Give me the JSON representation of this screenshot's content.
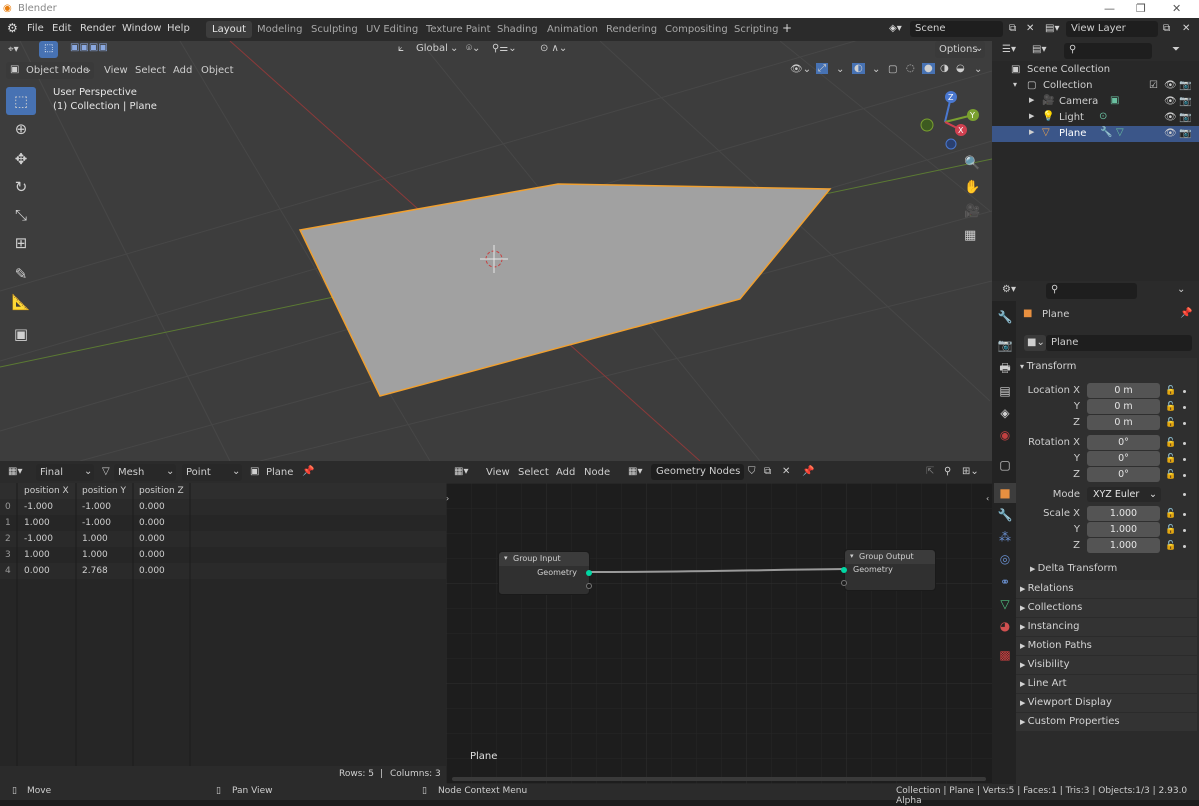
{
  "window": {
    "title": "Blender"
  },
  "menu": {
    "file": "File",
    "edit": "Edit",
    "render": "Render",
    "window": "Window",
    "help": "Help"
  },
  "workspaces": [
    {
      "label": "Layout",
      "active": true
    },
    {
      "label": "Modeling"
    },
    {
      "label": "Sculpting"
    },
    {
      "label": "UV Editing"
    },
    {
      "label": "Texture Paint"
    },
    {
      "label": "Shading"
    },
    {
      "label": "Animation"
    },
    {
      "label": "Rendering"
    },
    {
      "label": "Compositing"
    },
    {
      "label": "Scripting"
    }
  ],
  "top_right": {
    "scene": "Scene",
    "view_layer": "View Layer"
  },
  "viewport": {
    "orientation": "Global",
    "options": "Options",
    "mode": "Object Mode",
    "menus": {
      "view": "View",
      "select": "Select",
      "add": "Add",
      "object": "Object"
    },
    "overlay_text_1": "User Perspective",
    "overlay_text_2": "(1) Collection | Plane",
    "gizmo": {
      "x": "X",
      "y": "Y",
      "z": "Z"
    }
  },
  "outliner": {
    "root": "Scene Collection",
    "collection": "Collection",
    "items": [
      {
        "label": "Camera"
      },
      {
        "label": "Light"
      },
      {
        "label": "Plane",
        "selected": true
      }
    ]
  },
  "properties": {
    "object_name": "Plane",
    "data_name": "Plane",
    "transform": {
      "header": "Transform",
      "location_label": "Location X",
      "location": [
        "0 m",
        "0 m",
        "0 m"
      ],
      "rotation_label": "Rotation X",
      "rotation": [
        "0°",
        "0°",
        "0°"
      ],
      "mode_label": "Mode",
      "mode": "XYZ Euler",
      "scale_label": "Scale X",
      "scale": [
        "1.000",
        "1.000",
        "1.000"
      ],
      "axis_y": "Y",
      "axis_z": "Z"
    },
    "delta_transform": "Delta Transform",
    "panels": [
      "Relations",
      "Collections",
      "Instancing",
      "Motion Paths",
      "Visibility",
      "Line Art",
      "Viewport Display",
      "Custom Properties"
    ]
  },
  "spreadsheet": {
    "header": {
      "evaluation": "Final",
      "domain_type": "Mesh",
      "domain": "Point",
      "object": "Plane"
    },
    "columns": [
      "position X",
      "position Y",
      "position Z"
    ],
    "rows": [
      {
        "index": "0",
        "x": "-1.000",
        "y": "-1.000",
        "z": "0.000"
      },
      {
        "index": "1",
        "x": "1.000",
        "y": "-1.000",
        "z": "0.000"
      },
      {
        "index": "2",
        "x": "-1.000",
        "y": "1.000",
        "z": "0.000"
      },
      {
        "index": "3",
        "x": "1.000",
        "y": "1.000",
        "z": "0.000"
      },
      {
        "index": "4",
        "x": "0.000",
        "y": "2.768",
        "z": "0.000"
      }
    ],
    "footer": {
      "rows": "Rows: 5",
      "separator": "|",
      "columns": "Columns: 3"
    }
  },
  "node_editor": {
    "menus": {
      "view": "View",
      "select": "Select",
      "add": "Add",
      "node": "Node"
    },
    "tree_name": "Geometry Nodes",
    "group_input": {
      "title": "Group Input",
      "socket": "Geometry"
    },
    "group_output": {
      "title": "Group Output",
      "socket": "Geometry"
    },
    "object_label": "Plane"
  },
  "statusbar": {
    "move": "Move",
    "pan": "Pan View",
    "context": "Node Context Menu",
    "info": "Collection | Plane | Verts:5 | Faces:1 | Tris:3 | Objects:1/3 | 2.93.0 Alpha"
  },
  "colors": {
    "selection": "#4772b3",
    "outline": "#ffa030",
    "header": "#2b2b2b",
    "viewport": "#3d3d3d"
  }
}
